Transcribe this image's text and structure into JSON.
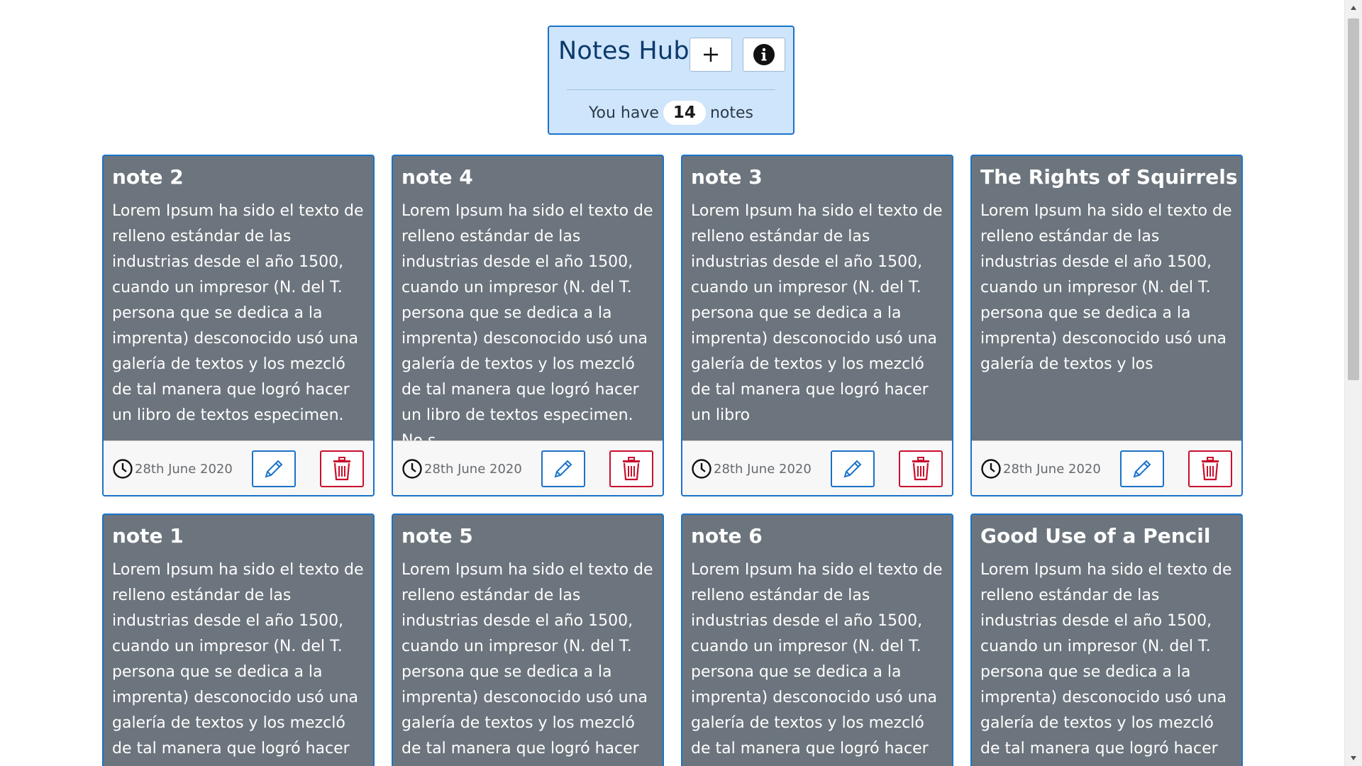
{
  "header": {
    "title": "Notes Hub",
    "add_icon": "plus-icon",
    "info_icon": "info-circle-icon",
    "count_prefix": "You have",
    "count": "14",
    "count_suffix": "notes"
  },
  "colors": {
    "accent": "#1a73c9",
    "header_bg": "#cfe5fb",
    "card_bg": "#6c757d",
    "delete": "#c8102e"
  },
  "notes": [
    {
      "title": "note 2",
      "text": "Lorem Ipsum ha sido el texto de relleno estándar de las industrias desde el año 1500, cuando un impresor (N. del T. persona que se dedica a la imprenta) desconocido usó una galería de textos y los mezcló de tal manera que logró hacer un libro de textos especimen.",
      "date": "28th June 2020"
    },
    {
      "title": "note 4",
      "text": "Lorem Ipsum ha sido el texto de relleno estándar de las industrias desde el año 1500, cuando un impresor (N. del T. persona que se dedica a la imprenta) desconocido usó una galería de textos y los mezcló de tal manera que logró hacer un libro de textos especimen. No s",
      "date": "28th June 2020"
    },
    {
      "title": "note 3",
      "text": "Lorem Ipsum ha sido el texto de relleno estándar de las industrias desde el año 1500, cuando un impresor (N. del T. persona que se dedica a la imprenta) desconocido usó una galería de textos y los mezcló de tal manera que logró hacer un libro",
      "date": "28th June 2020"
    },
    {
      "title": "The Rights of Squirrels",
      "text": "Lorem Ipsum ha sido el texto de relleno estándar de las industrias desde el año 1500, cuando un impresor (N. del T. persona que se dedica a la imprenta) desconocido usó una galería de textos y los",
      "date": "28th June 2020"
    },
    {
      "title": "note 1",
      "text": "Lorem Ipsum ha sido el texto de relleno estándar de las industrias desde el año 1500, cuando un impresor (N. del T. persona que se dedica a la imprenta) desconocido usó una galería de textos y los mezcló de tal manera que logró hacer un libro de",
      "date": ""
    },
    {
      "title": "note 5",
      "text": "Lorem Ipsum ha sido el texto de relleno estándar de las industrias desde el año 1500, cuando un impresor (N. del T. persona que se dedica a la imprenta) desconocido usó una galería de textos y los mezcló de tal manera que logró hacer un libro d",
      "date": ""
    },
    {
      "title": "note 6",
      "text": "Lorem Ipsum ha sido el texto de relleno estándar de las industrias desde el año 1500, cuando un impresor (N. del T. persona que se dedica a la imprenta) desconocido usó una galería de textos y los mezcló de tal manera que logró hacer un lib",
      "date": ""
    },
    {
      "title": "Good Use of a Pencil",
      "text": "Lorem Ipsum ha sido el texto de relleno estándar de las industrias desde el año 1500, cuando un impresor (N. del T. persona que se dedica a la imprenta) desconocido usó una galería de textos y los mezcló de tal manera que logró hacer un libro de",
      "date": ""
    }
  ]
}
